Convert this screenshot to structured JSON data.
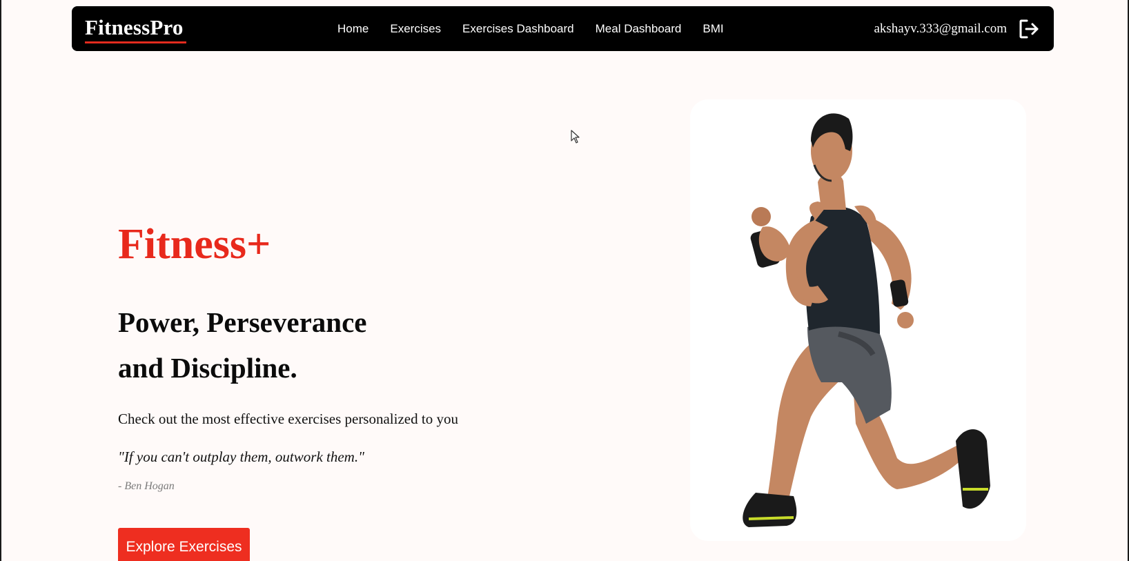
{
  "navbar": {
    "brand": "FitnessPro",
    "links": [
      {
        "label": "Home"
      },
      {
        "label": "Exercises"
      },
      {
        "label": "Exercises Dashboard"
      },
      {
        "label": "Meal Dashboard"
      },
      {
        "label": "BMI"
      }
    ],
    "user_email": "akshayv.333@gmail.com",
    "logout_icon": "logout-icon"
  },
  "hero": {
    "title": "Fitness+",
    "heading_line1": "Power, Perseverance",
    "heading_line2": "and Discipline.",
    "subtitle": "Check out the most effective exercises personalized to you",
    "quote": "\"If you can't outplay them, outwork them.\"",
    "quote_author": "- Ben Hogan",
    "cta_label": "Explore Exercises",
    "image_icon": "athlete-running-image"
  },
  "colors": {
    "accent": "#e8291c",
    "button": "#ee2e20",
    "navbar_bg": "#000000",
    "page_bg": "#fffaf9"
  }
}
